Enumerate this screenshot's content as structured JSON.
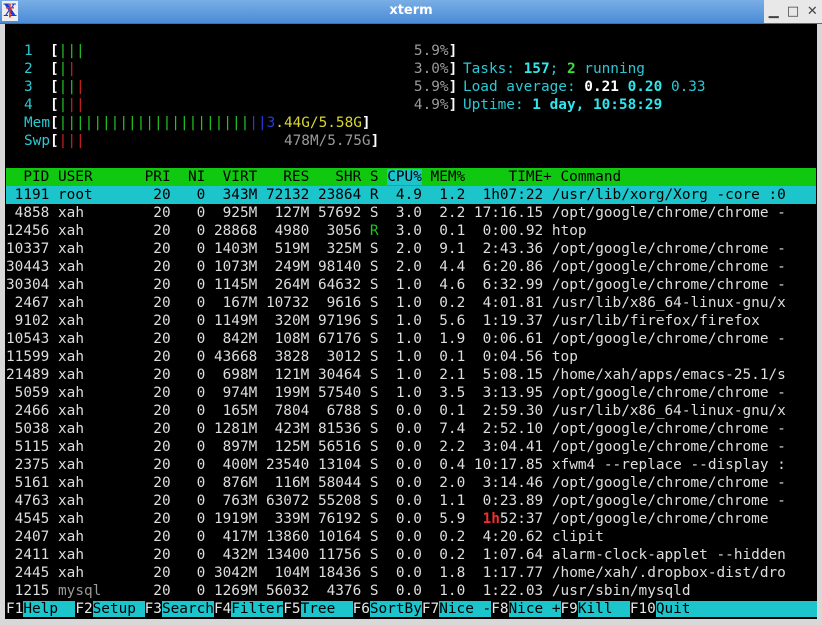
{
  "window": {
    "title": "xterm",
    "icon": "xterm-icon",
    "controls": [
      "minimize",
      "maximize",
      "close"
    ]
  },
  "meters": {
    "cpus": [
      {
        "label": "1",
        "percent": "5.9%",
        "bars": [
          {
            "char": "|",
            "color": "green"
          },
          {
            "char": "|",
            "color": "green"
          },
          {
            "char": "|",
            "color": "green"
          }
        ]
      },
      {
        "label": "2",
        "percent": "3.0%",
        "bars": [
          {
            "char": "|",
            "color": "green"
          },
          {
            "char": "|",
            "color": "red"
          }
        ]
      },
      {
        "label": "3",
        "percent": "5.9%",
        "bars": [
          {
            "char": "|",
            "color": "green"
          },
          {
            "char": "|",
            "color": "green"
          },
          {
            "char": "|",
            "color": "red"
          }
        ]
      },
      {
        "label": "4",
        "percent": "4.9%",
        "bars": [
          {
            "char": "|",
            "color": "green"
          },
          {
            "char": "|",
            "color": "red"
          },
          {
            "char": "|",
            "color": "red"
          }
        ]
      }
    ],
    "mem": {
      "label": "Mem",
      "used_green_bars": 22,
      "used_blue_bars": 2,
      "value_prefix": "3",
      "value": ".44G/5.58G"
    },
    "swp": {
      "label": "Swp",
      "red_bars": 3,
      "value": "478M/5.75G"
    }
  },
  "summary": {
    "tasks_label": "Tasks: ",
    "tasks": "157",
    "tasks_sep": "; ",
    "running": "2",
    "running_label": " running",
    "load_label": "Load average: ",
    "load1": "0.21",
    "load5": "0.20",
    "load15": "0.33",
    "uptime_label": "Uptime: ",
    "uptime": "1 day, 10:58:29"
  },
  "table": {
    "columns": [
      "PID",
      "USER",
      "PRI",
      "NI",
      "VIRT",
      "RES",
      "SHR",
      "S",
      "CPU%",
      "MEM%",
      "TIME+",
      "Command"
    ],
    "sorted_column": "CPU%",
    "selected_row": 0,
    "rows": [
      {
        "pid": "1191",
        "user": "root",
        "pri": "20",
        "ni": "0",
        "virt": "343M",
        "res": "72132",
        "shr": "23864",
        "s": "R",
        "cpu": "4.9",
        "mem": "1.2",
        "time": "1h07:22",
        "cmd": "/usr/lib/xorg/Xorg -core :0"
      },
      {
        "pid": "4858",
        "user": "xah",
        "pri": "20",
        "ni": "0",
        "virt": "925M",
        "res": "127M",
        "shr": "57692",
        "s": "S",
        "cpu": "3.0",
        "mem": "2.2",
        "time": "17:16.15",
        "cmd": "/opt/google/chrome/chrome -"
      },
      {
        "pid": "12456",
        "user": "xah",
        "pri": "20",
        "ni": "0",
        "virt": "28868",
        "res": "4980",
        "shr": "3056",
        "s": "R",
        "cpu": "3.0",
        "mem": "0.1",
        "time": "0:00.92",
        "cmd": "htop"
      },
      {
        "pid": "10337",
        "user": "xah",
        "pri": "20",
        "ni": "0",
        "virt": "1403M",
        "res": "519M",
        "shr": "325M",
        "s": "S",
        "cpu": "2.0",
        "mem": "9.1",
        "time": "2:43.36",
        "cmd": "/opt/google/chrome/chrome -"
      },
      {
        "pid": "30443",
        "user": "xah",
        "pri": "20",
        "ni": "0",
        "virt": "1073M",
        "res": "249M",
        "shr": "98140",
        "s": "S",
        "cpu": "2.0",
        "mem": "4.4",
        "time": "6:20.86",
        "cmd": "/opt/google/chrome/chrome -"
      },
      {
        "pid": "30304",
        "user": "xah",
        "pri": "20",
        "ni": "0",
        "virt": "1145M",
        "res": "264M",
        "shr": "64632",
        "s": "S",
        "cpu": "1.0",
        "mem": "4.6",
        "time": "6:32.99",
        "cmd": "/opt/google/chrome/chrome -"
      },
      {
        "pid": "2467",
        "user": "xah",
        "pri": "20",
        "ni": "0",
        "virt": "167M",
        "res": "10732",
        "shr": "9616",
        "s": "S",
        "cpu": "1.0",
        "mem": "0.2",
        "time": "4:01.81",
        "cmd": "/usr/lib/x86_64-linux-gnu/x"
      },
      {
        "pid": "9102",
        "user": "xah",
        "pri": "20",
        "ni": "0",
        "virt": "1149M",
        "res": "320M",
        "shr": "97196",
        "s": "S",
        "cpu": "1.0",
        "mem": "5.6",
        "time": "1:19.37",
        "cmd": "/usr/lib/firefox/firefox"
      },
      {
        "pid": "10543",
        "user": "xah",
        "pri": "20",
        "ni": "0",
        "virt": "842M",
        "res": "108M",
        "shr": "67176",
        "s": "S",
        "cpu": "1.0",
        "mem": "1.9",
        "time": "0:06.61",
        "cmd": "/opt/google/chrome/chrome -"
      },
      {
        "pid": "11599",
        "user": "xah",
        "pri": "20",
        "ni": "0",
        "virt": "43668",
        "res": "3828",
        "shr": "3012",
        "s": "S",
        "cpu": "1.0",
        "mem": "0.1",
        "time": "0:04.56",
        "cmd": "top"
      },
      {
        "pid": "21489",
        "user": "xah",
        "pri": "20",
        "ni": "0",
        "virt": "698M",
        "res": "121M",
        "shr": "30464",
        "s": "S",
        "cpu": "1.0",
        "mem": "2.1",
        "time": "5:08.15",
        "cmd": "/home/xah/apps/emacs-25.1/s"
      },
      {
        "pid": "5059",
        "user": "xah",
        "pri": "20",
        "ni": "0",
        "virt": "974M",
        "res": "199M",
        "shr": "57540",
        "s": "S",
        "cpu": "1.0",
        "mem": "3.5",
        "time": "3:13.95",
        "cmd": "/opt/google/chrome/chrome -"
      },
      {
        "pid": "2466",
        "user": "xah",
        "pri": "20",
        "ni": "0",
        "virt": "165M",
        "res": "7804",
        "shr": "6788",
        "s": "S",
        "cpu": "0.0",
        "mem": "0.1",
        "time": "2:59.30",
        "cmd": "/usr/lib/x86_64-linux-gnu/x"
      },
      {
        "pid": "5038",
        "user": "xah",
        "pri": "20",
        "ni": "0",
        "virt": "1281M",
        "res": "423M",
        "shr": "81536",
        "s": "S",
        "cpu": "0.0",
        "mem": "7.4",
        "time": "2:52.10",
        "cmd": "/opt/google/chrome/chrome -"
      },
      {
        "pid": "5115",
        "user": "xah",
        "pri": "20",
        "ni": "0",
        "virt": "897M",
        "res": "125M",
        "shr": "56516",
        "s": "S",
        "cpu": "0.0",
        "mem": "2.2",
        "time": "3:04.41",
        "cmd": "/opt/google/chrome/chrome -"
      },
      {
        "pid": "2375",
        "user": "xah",
        "pri": "20",
        "ni": "0",
        "virt": "400M",
        "res": "23540",
        "shr": "13104",
        "s": "S",
        "cpu": "0.0",
        "mem": "0.4",
        "time": "10:17.85",
        "cmd": "xfwm4 --replace --display :"
      },
      {
        "pid": "5161",
        "user": "xah",
        "pri": "20",
        "ni": "0",
        "virt": "876M",
        "res": "116M",
        "shr": "58044",
        "s": "S",
        "cpu": "0.0",
        "mem": "2.0",
        "time": "3:14.46",
        "cmd": "/opt/google/chrome/chrome -"
      },
      {
        "pid": "4763",
        "user": "xah",
        "pri": "20",
        "ni": "0",
        "virt": "763M",
        "res": "63072",
        "shr": "55208",
        "s": "S",
        "cpu": "0.0",
        "mem": "1.1",
        "time": "0:23.89",
        "cmd": "/opt/google/chrome/chrome -"
      },
      {
        "pid": "4545",
        "user": "xah",
        "pri": "20",
        "ni": "0",
        "virt": "1919M",
        "res": "339M",
        "shr": "76192",
        "s": "S",
        "cpu": "0.0",
        "mem": "5.9",
        "time": "1h52:37",
        "cmd": "/opt/google/chrome/chrome"
      },
      {
        "pid": "2407",
        "user": "xah",
        "pri": "20",
        "ni": "0",
        "virt": "417M",
        "res": "13860",
        "shr": "10164",
        "s": "S",
        "cpu": "0.0",
        "mem": "0.2",
        "time": "4:20.62",
        "cmd": "clipit"
      },
      {
        "pid": "2411",
        "user": "xah",
        "pri": "20",
        "ni": "0",
        "virt": "432M",
        "res": "13400",
        "shr": "11756",
        "s": "S",
        "cpu": "0.0",
        "mem": "0.2",
        "time": "1:07.64",
        "cmd": "alarm-clock-applet --hidden"
      },
      {
        "pid": "2445",
        "user": "xah",
        "pri": "20",
        "ni": "0",
        "virt": "3042M",
        "res": "104M",
        "shr": "18436",
        "s": "S",
        "cpu": "0.0",
        "mem": "1.8",
        "time": "1:17.77",
        "cmd": "/home/xah/.dropbox-dist/dro"
      },
      {
        "pid": "1215",
        "user": "mysql",
        "pri": "20",
        "ni": "0",
        "virt": "1269M",
        "res": "56032",
        "shr": "4376",
        "s": "S",
        "cpu": "0.0",
        "mem": "1.0",
        "time": "1:22.03",
        "cmd": "/usr/sbin/mysqld"
      }
    ]
  },
  "footer": [
    {
      "key": "F1",
      "label": "Help  "
    },
    {
      "key": "F2",
      "label": "Setup "
    },
    {
      "key": "F3",
      "label": "Search"
    },
    {
      "key": "F4",
      "label": "Filter"
    },
    {
      "key": "F5",
      "label": "Tree  "
    },
    {
      "key": "F6",
      "label": "SortBy"
    },
    {
      "key": "F7",
      "label": "Nice -"
    },
    {
      "key": "F8",
      "label": "Nice +"
    },
    {
      "key": "F9",
      "label": "Kill  "
    },
    {
      "key": "F10",
      "label": "Quit                  "
    }
  ],
  "colors": {
    "header_bg": "#10c810",
    "selected_bg": "#1cc4cc",
    "meter_green": "#22c322",
    "meter_red": "#cc2020",
    "meter_blue": "#2a3ad8",
    "label_cyan": "#2bc8d4"
  }
}
